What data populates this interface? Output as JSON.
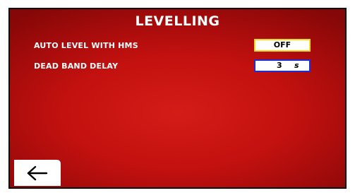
{
  "screen": {
    "title": "LEVELLING"
  },
  "settings": [
    {
      "label": "AUTO LEVEL WITH HMS",
      "value": "OFF"
    },
    {
      "label": "DEAD BAND DELAY",
      "value": "3",
      "unit": "s"
    }
  ],
  "colors": {
    "background": "#c3110f",
    "toggle_border": "#f3dc1e",
    "input_border": "#1b2fd6"
  },
  "icons": {
    "back": "left-arrow-icon"
  }
}
